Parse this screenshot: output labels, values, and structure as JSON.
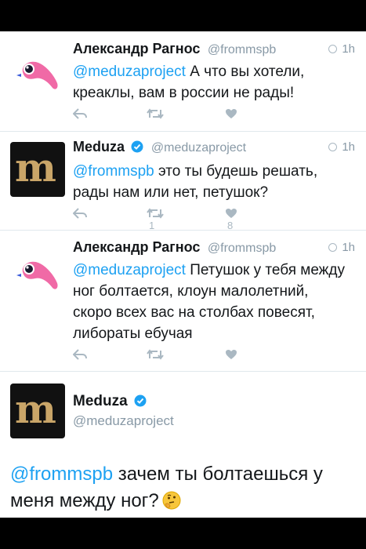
{
  "colors": {
    "link": "#1da1f2",
    "muted": "#8899a6",
    "icon": "#aab8c2",
    "verified": "#1da1f2",
    "meduza_gold": "#c9a568"
  },
  "tweets": [
    {
      "author": "Александр Рагнос",
      "handle": "@frommspb",
      "time": "1h",
      "mention": "@meduzaproject",
      "text": " А что вы хотели, креаклы, вам в россии не рады!",
      "retweets": "",
      "likes": ""
    },
    {
      "author": "Meduza",
      "handle": "@meduzaproject",
      "time": "1h",
      "mention": "@frommspb",
      "text": " это ты будешь решать, рады нам или нет, петушок?",
      "retweets": "1",
      "likes": "8"
    },
    {
      "author": "Александр Рагнос",
      "handle": "@frommspb",
      "time": "1h",
      "mention": "@meduzaproject",
      "text": " Петушок у тебя между ног болтается, клоун малолетний, скоро всех вас на столбах повесят, либораты ебучая",
      "retweets": "",
      "likes": ""
    }
  ],
  "open_tweet": {
    "author": "Meduza",
    "handle": "@meduzaproject",
    "mention": "@frommspb",
    "text": " зачем ты болтаешься у меня между ног?",
    "emoji": "thinking-face-emoji"
  },
  "icons": [
    "reply-icon",
    "retweet-icon",
    "like-icon",
    "clock-icon",
    "verified-icon"
  ],
  "meduza_logo_letter": "m"
}
